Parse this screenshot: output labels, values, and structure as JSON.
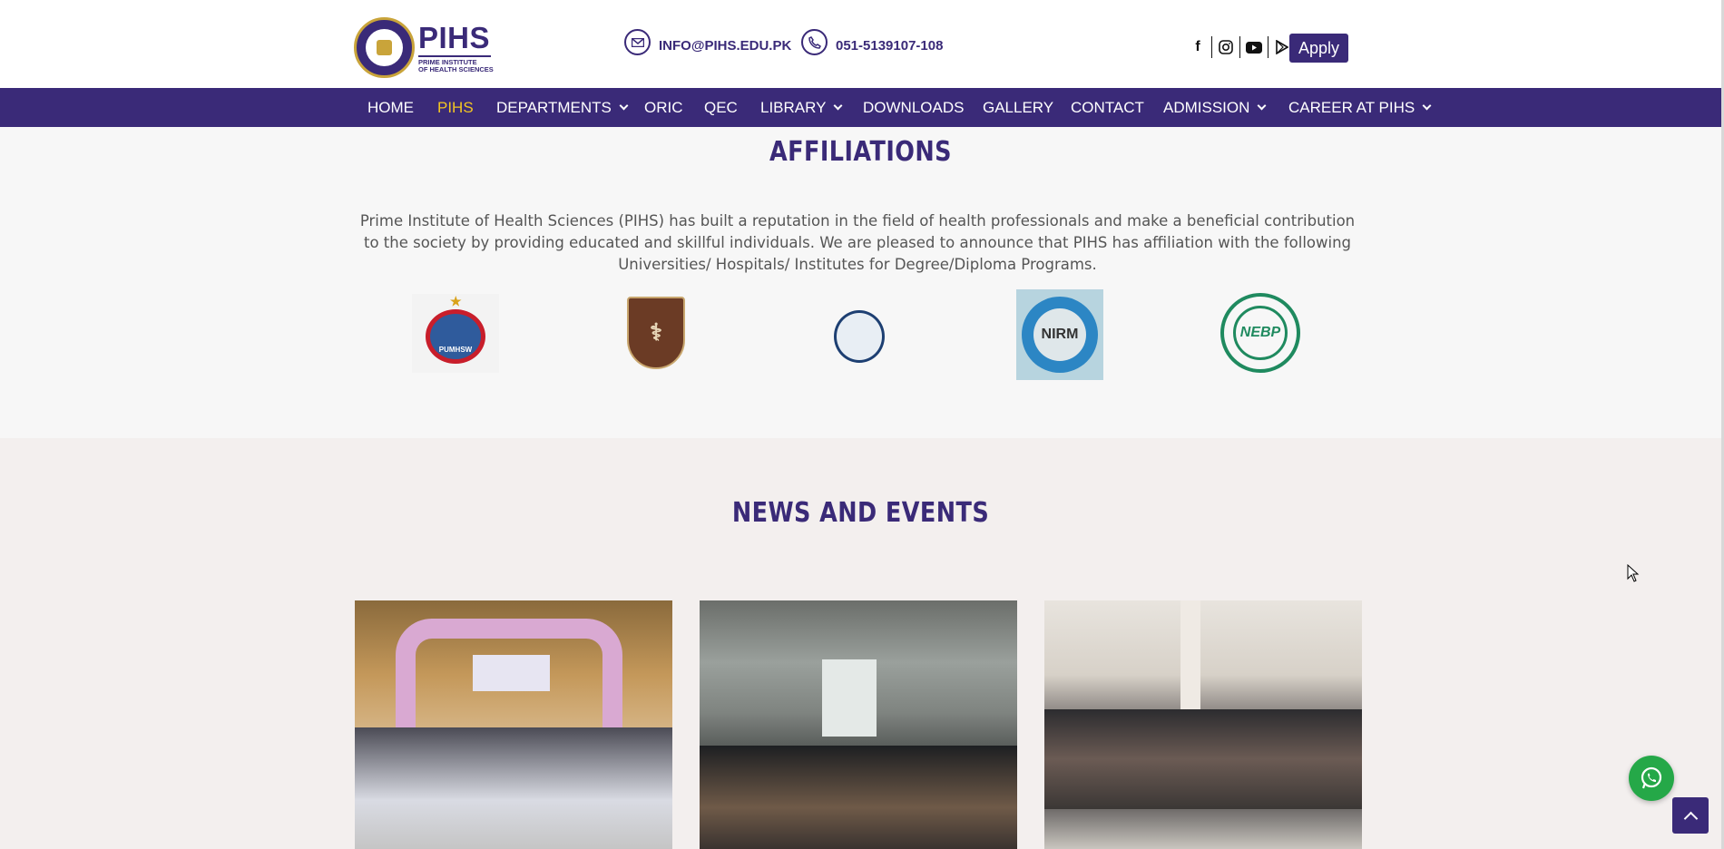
{
  "header": {
    "logo_main": "PIHS",
    "logo_sub_1": "PRIME INSTITUTE",
    "logo_sub_2": "OF HEALTH SCIENCES",
    "email": "INFO@PIHS.EDU.PK",
    "phone": "051-5139107-108",
    "socials": [
      "facebook-icon",
      "instagram-icon",
      "youtube-icon",
      "google-play-icon"
    ],
    "apply_label": "Apply"
  },
  "nav": {
    "items": [
      {
        "label": "HOME",
        "dropdown": false
      },
      {
        "label": "PIHS",
        "dropdown": false,
        "active": true
      },
      {
        "label": "DEPARTMENTS",
        "dropdown": true
      },
      {
        "label": "ORIC",
        "dropdown": false
      },
      {
        "label": "QEC",
        "dropdown": false
      },
      {
        "label": "LIBRARY",
        "dropdown": true
      },
      {
        "label": "DOWNLOADS",
        "dropdown": false
      },
      {
        "label": "GALLERY",
        "dropdown": false
      },
      {
        "label": "CONTACT",
        "dropdown": false
      },
      {
        "label": "ADMISSION",
        "dropdown": true
      },
      {
        "label": "CAREER AT PIHS",
        "dropdown": true
      }
    ]
  },
  "affiliations": {
    "title": "AFFILIATIONS",
    "text": "Prime Institute of Health Sciences (PIHS) has built a reputation in the field of health professionals and make a beneficial contribution to the society by providing educated and skillful individuals. We are pleased to announce that PIHS has affiliation with the following Universities/ Hospitals/ Institutes for Degree/Diploma Programs.",
    "logos": {
      "pumhsw": "PUMHSW",
      "fg_polyclinic": "F.G. POLYCLINIC",
      "nirm": "NIRM",
      "nebp": "NEBP"
    }
  },
  "news": {
    "title": "NEWS AND EVENTS",
    "cards": [
      "event-photo-1",
      "event-photo-2",
      "event-photo-3"
    ]
  },
  "colors": {
    "brand": "#3a2a78",
    "active_nav": "#f3c622",
    "whatsapp": "#25a848"
  }
}
